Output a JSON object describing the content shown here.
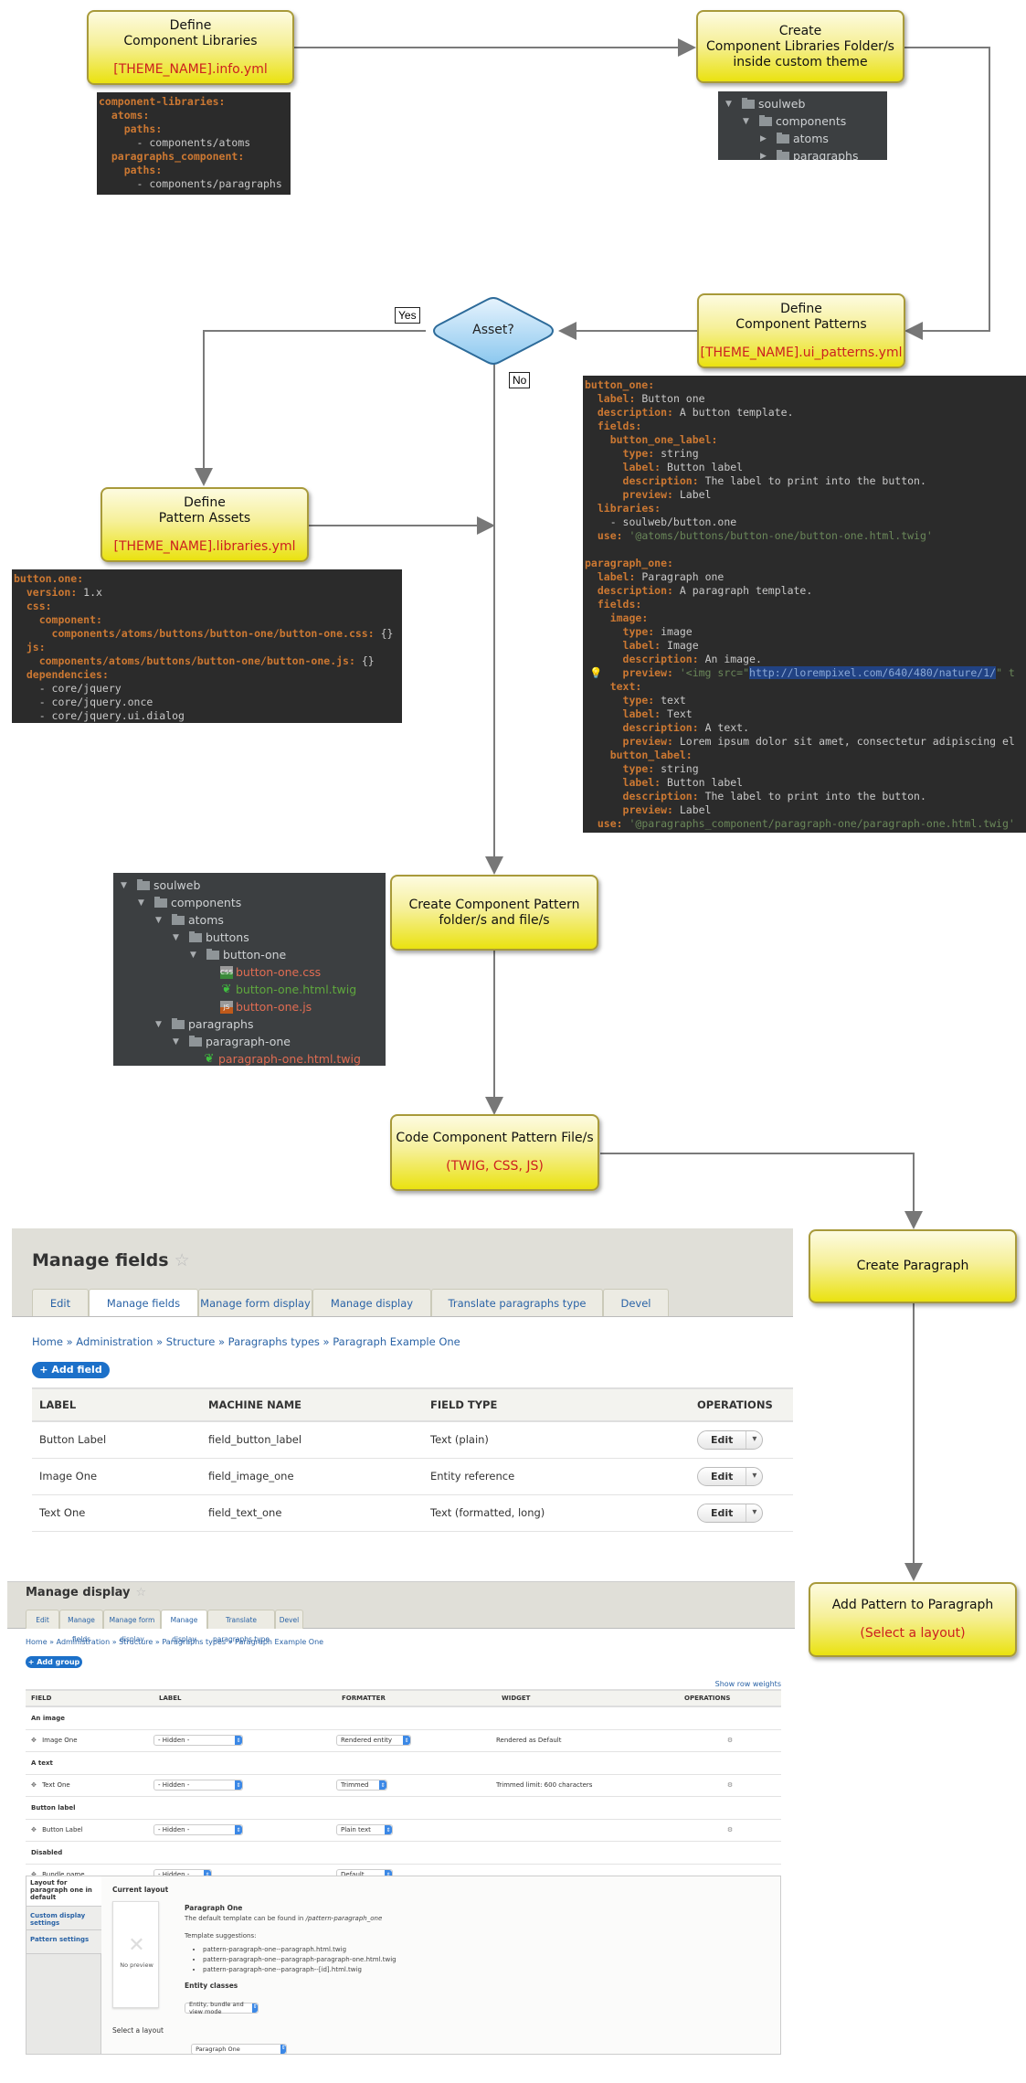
{
  "flow": {
    "define_libraries": {
      "title_line1": "Define",
      "title_line2": "Component Libraries",
      "file": "[THEME_NAME].info.yml"
    },
    "create_folders": {
      "title_line1": "Create",
      "title_line2": "Component Libraries Folder/s",
      "title_line3": "inside custom theme"
    },
    "define_patterns": {
      "title_line1": "Define",
      "title_line2": "Component Patterns",
      "file": "[THEME_NAME].ui_patterns.yml"
    },
    "asset_decision": {
      "label": "Asset?",
      "yes": "Yes",
      "no": "No"
    },
    "define_assets": {
      "title_line1": "Define",
      "title_line2": "Pattern Assets",
      "file": "[THEME_NAME].libraries.yml"
    },
    "create_pattern_files": {
      "title_line1": "Create Component Pattern",
      "title_line2": "folder/s and file/s"
    },
    "code_pattern_files": {
      "title": "Code Component Pattern File/s",
      "sub": "(TWIG, CSS, JS)"
    },
    "create_paragraph": {
      "title": "Create Paragraph"
    },
    "add_pattern": {
      "title": "Add Pattern to Paragraph",
      "sub": "(Select a layout)"
    }
  },
  "info_yml": [
    [
      {
        "t": "component-libraries:",
        "c": "k"
      }
    ],
    [
      {
        "t": "  "
      },
      {
        "t": "atoms:",
        "c": "k"
      }
    ],
    [
      {
        "t": "    "
      },
      {
        "t": "paths:",
        "c": "k"
      }
    ],
    [
      {
        "t": "      - components/atoms"
      }
    ],
    [
      {
        "t": "  "
      },
      {
        "t": "paragraphs_component:",
        "c": "k"
      }
    ],
    [
      {
        "t": "    "
      },
      {
        "t": "paths:",
        "c": "k"
      }
    ],
    [
      {
        "t": "      - components/paragraphs"
      }
    ]
  ],
  "tree_small": [
    {
      "depth": 0,
      "arrow": "▼",
      "name": "soulweb"
    },
    {
      "depth": 1,
      "arrow": "▼",
      "name": "components"
    },
    {
      "depth": 2,
      "arrow": "▶",
      "name": "atoms"
    },
    {
      "depth": 2,
      "arrow": "▶",
      "name": "paragraphs"
    }
  ],
  "ui_patterns_yml": [
    [
      {
        "t": "button_one:",
        "c": "k"
      }
    ],
    [
      {
        "t": "  "
      },
      {
        "t": "label:",
        "c": "k"
      },
      {
        "t": " Button one"
      }
    ],
    [
      {
        "t": "  "
      },
      {
        "t": "description:",
        "c": "k"
      },
      {
        "t": " A button template."
      }
    ],
    [
      {
        "t": "  "
      },
      {
        "t": "fields:",
        "c": "k"
      }
    ],
    [
      {
        "t": "    "
      },
      {
        "t": "button_one_label:",
        "c": "k"
      }
    ],
    [
      {
        "t": "      "
      },
      {
        "t": "type:",
        "c": "k"
      },
      {
        "t": " string"
      }
    ],
    [
      {
        "t": "      "
      },
      {
        "t": "label:",
        "c": "k"
      },
      {
        "t": " Button label"
      }
    ],
    [
      {
        "t": "      "
      },
      {
        "t": "description:",
        "c": "k"
      },
      {
        "t": " The label to print into the button."
      }
    ],
    [
      {
        "t": "      "
      },
      {
        "t": "preview:",
        "c": "k"
      },
      {
        "t": " Label"
      }
    ],
    [
      {
        "t": "  "
      },
      {
        "t": "libraries:",
        "c": "k"
      }
    ],
    [
      {
        "t": "    - soulweb/button.one"
      }
    ],
    [
      {
        "t": "  "
      },
      {
        "t": "use:",
        "c": "k"
      },
      {
        "t": " '@atoms/buttons/button-one/button-one.html.twig'",
        "c": "s"
      }
    ],
    [
      {
        "t": " "
      }
    ],
    [
      {
        "t": "paragraph_one:",
        "c": "k"
      }
    ],
    [
      {
        "t": "  "
      },
      {
        "t": "label:",
        "c": "k"
      },
      {
        "t": " Paragraph one"
      }
    ],
    [
      {
        "t": "  "
      },
      {
        "t": "description:",
        "c": "k"
      },
      {
        "t": " A paragraph template."
      }
    ],
    [
      {
        "t": "  "
      },
      {
        "t": "fields:",
        "c": "k"
      }
    ],
    [
      {
        "t": "    "
      },
      {
        "t": "image:",
        "c": "k"
      }
    ],
    [
      {
        "t": "      "
      },
      {
        "t": "type:",
        "c": "k"
      },
      {
        "t": " image"
      }
    ],
    [
      {
        "t": "      "
      },
      {
        "t": "label:",
        "c": "k"
      },
      {
        "t": " Image"
      }
    ],
    [
      {
        "t": "      "
      },
      {
        "t": "description:",
        "c": "k"
      },
      {
        "t": " An image."
      }
    ],
    [
      {
        "t": "      "
      },
      {
        "t": "preview:",
        "c": "k"
      },
      {
        "t": " '<img src=\"",
        "c": "s"
      },
      {
        "t": "http://lorempixel.com/640/480/nature/1/",
        "c": "sel"
      },
      {
        "t": "\" t",
        "c": "s"
      }
    ],
    [
      {
        "t": "    "
      },
      {
        "t": "text:",
        "c": "k"
      }
    ],
    [
      {
        "t": "      "
      },
      {
        "t": "type:",
        "c": "k"
      },
      {
        "t": " text"
      }
    ],
    [
      {
        "t": "      "
      },
      {
        "t": "label:",
        "c": "k"
      },
      {
        "t": " Text"
      }
    ],
    [
      {
        "t": "      "
      },
      {
        "t": "description:",
        "c": "k"
      },
      {
        "t": " A text."
      }
    ],
    [
      {
        "t": "      "
      },
      {
        "t": "preview:",
        "c": "k"
      },
      {
        "t": " Lorem ipsum dolor sit amet, consectetur adipiscing el"
      }
    ],
    [
      {
        "t": "    "
      },
      {
        "t": "button_label:",
        "c": "k"
      }
    ],
    [
      {
        "t": "      "
      },
      {
        "t": "type:",
        "c": "k"
      },
      {
        "t": " string"
      }
    ],
    [
      {
        "t": "      "
      },
      {
        "t": "label:",
        "c": "k"
      },
      {
        "t": " Button label"
      }
    ],
    [
      {
        "t": "      "
      },
      {
        "t": "description:",
        "c": "k"
      },
      {
        "t": " The label to print into the button."
      }
    ],
    [
      {
        "t": "      "
      },
      {
        "t": "preview:",
        "c": "k"
      },
      {
        "t": " Label"
      }
    ],
    [
      {
        "t": "  "
      },
      {
        "t": "use:",
        "c": "k"
      },
      {
        "t": " '@paragraphs_component/paragraph-one/paragraph-one.html.twig'",
        "c": "s"
      }
    ]
  ],
  "libraries_yml": [
    [
      {
        "t": "button.one:",
        "c": "k"
      }
    ],
    [
      {
        "t": "  "
      },
      {
        "t": "version:",
        "c": "k"
      },
      {
        "t": " 1.x"
      }
    ],
    [
      {
        "t": "  "
      },
      {
        "t": "css:",
        "c": "k"
      }
    ],
    [
      {
        "t": "    "
      },
      {
        "t": "component:",
        "c": "k"
      }
    ],
    [
      {
        "t": "      "
      },
      {
        "t": "components/atoms/buttons/button-one/button-one.css:",
        "c": "k"
      },
      {
        "t": " {}"
      }
    ],
    [
      {
        "t": "  "
      },
      {
        "t": "js:",
        "c": "k"
      }
    ],
    [
      {
        "t": "    "
      },
      {
        "t": "components/atoms/buttons/button-one/button-one.js:",
        "c": "k"
      },
      {
        "t": " {}"
      }
    ],
    [
      {
        "t": "  "
      },
      {
        "t": "dependencies:",
        "c": "k"
      }
    ],
    [
      {
        "t": "    - core/jquery"
      }
    ],
    [
      {
        "t": "    - core/jquery.once"
      }
    ],
    [
      {
        "t": "    - core/jquery.ui.dialog"
      }
    ]
  ],
  "tree_full": [
    {
      "depth": 0,
      "arrow": "▼",
      "name": "soulweb",
      "type": "folder"
    },
    {
      "depth": 1,
      "arrow": "▼",
      "name": "components",
      "type": "folder"
    },
    {
      "depth": 2,
      "arrow": "▼",
      "name": "atoms",
      "type": "folder"
    },
    {
      "depth": 3,
      "arrow": "▼",
      "name": "buttons",
      "type": "folder"
    },
    {
      "depth": 4,
      "arrow": "▼",
      "name": "button-one",
      "type": "folder"
    },
    {
      "depth": 5,
      "arrow": "",
      "name": "button-one.css",
      "type": "css",
      "icon_label": "CSS"
    },
    {
      "depth": 5,
      "arrow": "",
      "name": "button-one.html.twig",
      "type": "twig"
    },
    {
      "depth": 5,
      "arrow": "",
      "name": "button-one.js",
      "type": "js",
      "icon_label": "JS"
    },
    {
      "depth": 2,
      "arrow": "▼",
      "name": "paragraphs",
      "type": "folder"
    },
    {
      "depth": 3,
      "arrow": "▼",
      "name": "paragraph-one",
      "type": "folder"
    },
    {
      "depth": 4,
      "arrow": "",
      "name": "paragraph-one.html.twig",
      "type": "twig-red"
    }
  ],
  "manage_fields": {
    "title": "Manage fields",
    "tabs": [
      "Edit",
      "Manage fields",
      "Manage form display",
      "Manage display",
      "Translate paragraphs type",
      "Devel"
    ],
    "active_tab": 1,
    "breadcrumb": "Home » Administration » Structure » Paragraphs types » Paragraph Example One",
    "add_button": "+ Add field",
    "columns": [
      "LABEL",
      "MACHINE NAME",
      "FIELD TYPE",
      "OPERATIONS"
    ],
    "rows": [
      {
        "label": "Button Label",
        "machine": "field_button_label",
        "type": "Text (plain)",
        "op": "Edit"
      },
      {
        "label": "Image One",
        "machine": "field_image_one",
        "type": "Entity reference",
        "op": "Edit"
      },
      {
        "label": "Text One",
        "machine": "field_text_one",
        "type": "Text (formatted, long)",
        "op": "Edit"
      }
    ]
  },
  "manage_display": {
    "title": "Manage display",
    "tabs": [
      "Edit",
      "Manage fields",
      "Manage form display",
      "Manage display",
      "Translate paragraphs type",
      "Devel"
    ],
    "active_tab": 3,
    "breadcrumb": "Home » Administration » Structure » Paragraphs types » Paragraph Example One",
    "add_button": "+ Add group",
    "show_weights": "Show row weights",
    "columns": [
      "FIELD",
      "LABEL",
      "FORMATTER",
      "WIDGET",
      "OPERATIONS"
    ],
    "groups": [
      {
        "region": "An image",
        "field": "Image One",
        "label": "- Hidden -",
        "formatter": "Rendered entity",
        "widget": "Rendered as Default",
        "gear": true
      },
      {
        "region": "A text",
        "field": "Text One",
        "label": "- Hidden -",
        "formatter": "Trimmed",
        "widget": "Trimmed limit: 600 characters",
        "gear": true
      },
      {
        "region": "Button label",
        "field": "Button Label",
        "label": "- Hidden -",
        "formatter": "Plain text",
        "widget": "",
        "gear": true
      },
      {
        "region": "Disabled",
        "field": "Bundle name",
        "label": "- Hidden -",
        "formatter": "Default",
        "widget": "",
        "gear": false
      }
    ],
    "layout": {
      "vtabs": [
        "Layout for paragraph one in default",
        "Custom display settings",
        "Pattern settings"
      ],
      "current_layout": "Current layout",
      "no_preview": "No preview",
      "pattern_name": "Paragraph One",
      "template_text": "The default template can be found in",
      "template_path": "/pattern-paragraph_one",
      "suggestions_label": "Template suggestions:",
      "suggestions": [
        "pattern-paragraph-one--paragraph.html.twig",
        "pattern-paragraph-one--paragraph-paragraph-one.html.twig",
        "pattern-paragraph-one--paragraph--[id].html.twig"
      ],
      "entity_classes_label": "Entity classes",
      "entity_classes_value": "Entity, bundle and view mode",
      "select_layout_label": "Select a layout",
      "select_layout_value": "Paragraph One"
    }
  }
}
